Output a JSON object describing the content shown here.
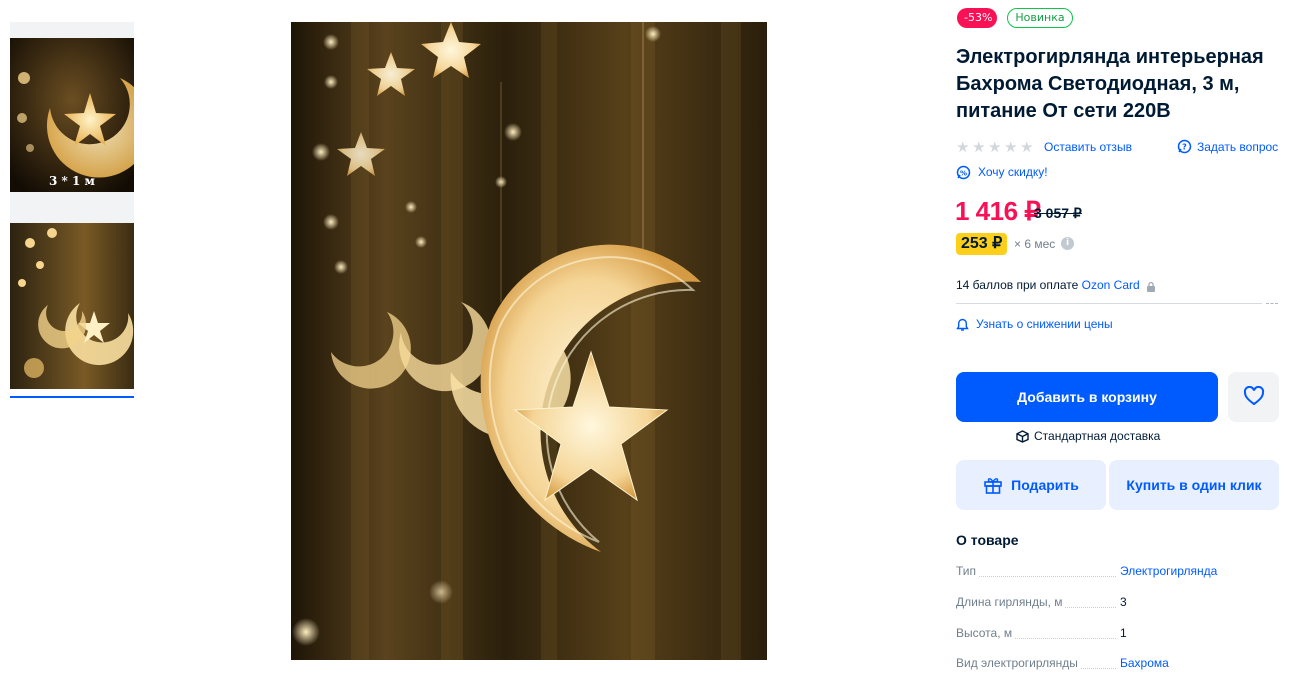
{
  "badges": {
    "discount": "-53%",
    "new": "Новинка"
  },
  "product": {
    "title": "Электрогирлянда интерьерная Бахрома Светодиодная, 3 м, питание От сети 220В"
  },
  "thumbnails": [
    {
      "caption": "3 * 1 м"
    },
    {
      "caption": ""
    }
  ],
  "rating": {
    "stars": 0,
    "max": 5
  },
  "actions": {
    "review": "Оставить отзыв",
    "ask": "Задать вопрос",
    "want_discount": "Хочу скидку!",
    "notify_price": "Узнать о снижении цены"
  },
  "price": {
    "current": "1 416 ₽",
    "old": "3 057 ₽",
    "installment_amount": "253 ₽",
    "installment_term": "× 6 мес"
  },
  "points": {
    "text": "14 баллов при оплате ",
    "card": "Ozon Card"
  },
  "buttons": {
    "add_to_cart": "Добавить в корзину",
    "gift": "Подарить",
    "one_click": "Купить в один клик"
  },
  "delivery": "Стандартная доставка",
  "about": {
    "title": "О товаре",
    "specs": [
      {
        "name": "Тип",
        "value": "Электрогирлянда"
      },
      {
        "name": "Длина гирлянды, м",
        "value": "3"
      },
      {
        "name": "Высота, м",
        "value": "1"
      },
      {
        "name": "Вид электрогирлянды",
        "value": "Бахрома"
      }
    ]
  },
  "colors": {
    "accent": "#005bff",
    "sale": "#f91155",
    "installment": "#fecf1a",
    "new_badge": "#10c44c"
  }
}
